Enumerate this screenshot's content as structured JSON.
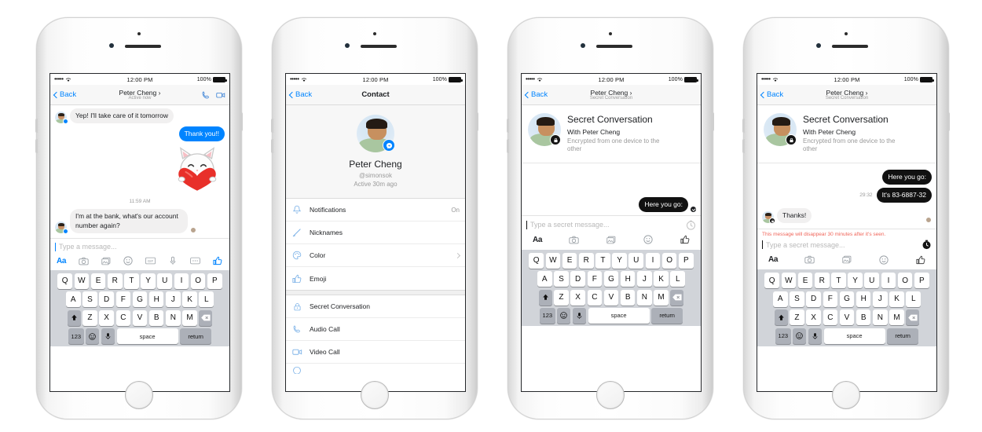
{
  "statusbar": {
    "signal": "•••••",
    "time": "12:00 PM",
    "battery": "100%"
  },
  "phone1": {
    "nav": {
      "back": "Back",
      "title": "Peter Cheng ›",
      "subtitle": "Active now",
      "phone_icon": "phone-icon",
      "video_icon": "video-camera-icon"
    },
    "messages": [
      {
        "side": "in",
        "text": "Yep! I'll take care of it tomorrow"
      },
      {
        "side": "out",
        "text": "Thank you!!"
      }
    ],
    "sticker": "cat-hugging-heart-sticker",
    "timestamp": "11:59 AM",
    "last_in": "I'm at the bank, what's our account number again?",
    "composer": {
      "placeholder": "Type a message...",
      "tools": [
        "Aa",
        "camera-icon",
        "photo-library-icon",
        "smiley-icon",
        "GIF",
        "microphone-icon",
        "more-dots-icon",
        "thumbs-up-icon"
      ]
    }
  },
  "phone2": {
    "nav": {
      "back": "Back",
      "title": "Contact"
    },
    "profile": {
      "name": "Peter Cheng",
      "handle": "@simonsok",
      "active": "Active 30m ago",
      "badge": "messenger-icon"
    },
    "menu_group1": [
      {
        "icon": "bell-icon",
        "label": "Notifications",
        "value": "On"
      },
      {
        "icon": "pencil-icon",
        "label": "Nicknames",
        "value": ""
      },
      {
        "icon": "palette-icon",
        "label": "Color",
        "value": "",
        "chevron": true
      },
      {
        "icon": "thumbs-up-icon",
        "label": "Emoji",
        "value": ""
      }
    ],
    "menu_group2": [
      {
        "icon": "lock-icon",
        "label": "Secret Conversation",
        "value": ""
      },
      {
        "icon": "phone-icon",
        "label": "Audio Call",
        "value": ""
      },
      {
        "icon": "video-camera-icon",
        "label": "Video Call",
        "value": ""
      }
    ]
  },
  "phone3": {
    "nav": {
      "back": "Back",
      "title": "Peter Cheng ›",
      "subtitle": "Secret Conversation"
    },
    "header": {
      "title": "Secret Conversation",
      "with": "With Peter Cheng",
      "encrypted": "Encrypted from one device to the other",
      "badge": "lock-icon"
    },
    "messages": [
      {
        "side": "out",
        "text": "Here you go:",
        "status": "delivered-check-icon"
      }
    ],
    "composer": {
      "placeholder": "Type a secret message...",
      "timer_icon": "timer-icon",
      "tools": [
        "Aa",
        "camera-icon",
        "photo-library-icon",
        "smiley-icon",
        "thumbs-up-icon"
      ]
    }
  },
  "phone4": {
    "nav": {
      "back": "Back",
      "title": "Peter Cheng ›",
      "subtitle": "Secret Conversation"
    },
    "header": {
      "title": "Secret Conversation",
      "with": "With Peter Cheng",
      "encrypted": "Encrypted from one device to the other",
      "badge": "lock-icon"
    },
    "messages": [
      {
        "side": "out",
        "text": "Here you go:",
        "expiry": ""
      },
      {
        "side": "out",
        "text": "It's 83-6887-32",
        "expiry": "29:32"
      },
      {
        "side": "in",
        "text": "Thanks!"
      }
    ],
    "warning": "This message will disappear 30 minutes after it's seen.",
    "composer": {
      "placeholder": "Type a secret message...",
      "timer_icon": "timer-icon-active",
      "tools": [
        "Aa",
        "camera-icon",
        "photo-library-icon",
        "smiley-icon",
        "thumbs-up-icon"
      ]
    }
  },
  "keyboard": {
    "row1": [
      "Q",
      "W",
      "E",
      "R",
      "T",
      "Y",
      "U",
      "I",
      "O",
      "P"
    ],
    "row2": [
      "A",
      "S",
      "D",
      "F",
      "G",
      "H",
      "J",
      "K",
      "L"
    ],
    "row3": [
      "Z",
      "X",
      "C",
      "V",
      "B",
      "N",
      "M"
    ],
    "shift": "shift-icon",
    "backspace": "backspace-icon",
    "num": "123",
    "emoji": "emoji-key-icon",
    "mic": "microphone-key-icon",
    "space": "space",
    "return": "return"
  },
  "colors": {
    "accent": "#0084ff",
    "secret": "#111111",
    "warning": "#f0655a",
    "bubble_gray": "#f1f0f0"
  }
}
